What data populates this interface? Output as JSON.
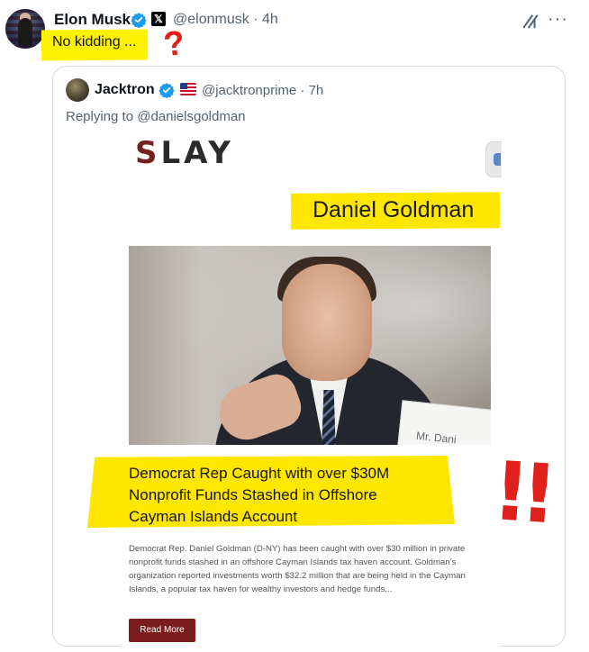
{
  "outer_tweet": {
    "author": "Elon Musk",
    "x_badge": "𝕏",
    "handle_time": "@elonmusk · 4h",
    "text": "No kidding ...",
    "annotation_question": "?",
    "more": "···",
    "icons": [
      "verified-badge-icon",
      "grok-icon",
      "more-options-icon"
    ]
  },
  "quote": {
    "author": "Jacktron",
    "handle_time": "@jacktronprime · 7h",
    "replying_to": "Replying to @danielsgoldman",
    "article": {
      "brand": "LAY",
      "brand_first_letter": "S",
      "name_caption": "Daniel Goldman",
      "placard_text": "Mr. Dani",
      "headline_line1": "Democrat Rep Caught with over $30M",
      "headline_line2": "Nonprofit Funds Stashed in Offshore",
      "headline_line3": "Cayman Islands Account",
      "annotation_exclaim": "!!",
      "summary": "Democrat Rep. Daniel Goldman (D-NY) has been caught with over $30 million in private nonprofit funds stashed in an offshore Cayman Islands tax haven account. Goldman’s organization reported investments worth $32.2 million that are being held in the Cayman Islands, a popular tax haven for wealthy investors and hedge funds...",
      "read_more": "Read More"
    }
  },
  "colors": {
    "highlight": "#ffe700",
    "annotation_red": "#e0211b",
    "verified_blue": "#1d9bf0",
    "muted_text": "#536471",
    "read_more_bg": "#7b1c1c"
  }
}
